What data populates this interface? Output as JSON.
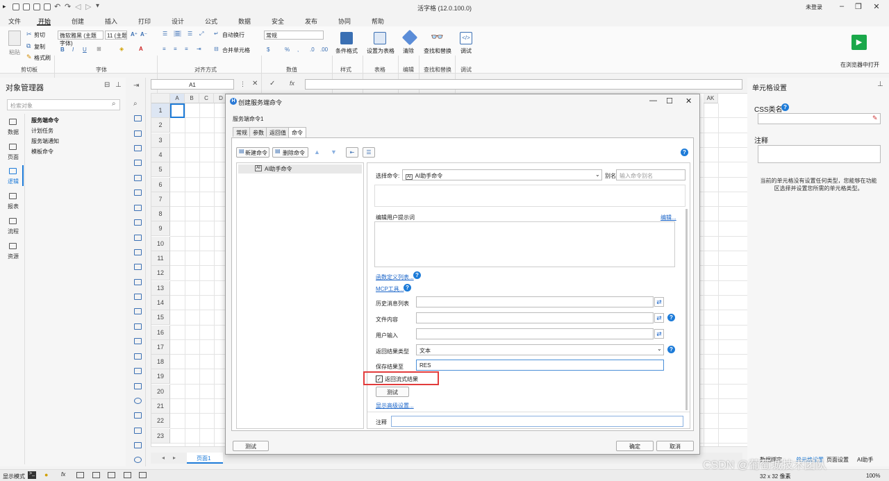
{
  "window": {
    "title": "活字格 (12.0.100.0)",
    "user": "未登录"
  },
  "menu": [
    "文件",
    "开始",
    "创建",
    "插入",
    "打印",
    "设计",
    "公式",
    "数据",
    "安全",
    "发布",
    "协同",
    "帮助"
  ],
  "ribbon": {
    "paste": "粘贴",
    "cut": "剪切",
    "copy": "复制",
    "format_painter": "格式刷",
    "clipboard": "剪切板",
    "font_name": "微软雅黑 (主题字体)",
    "font_size": "11 (主题字号)",
    "font": "字体",
    "wrap": "自动换行",
    "merge": "合并单元格",
    "alignment": "对齐方式",
    "number_format": "常规",
    "number": "数值",
    "cond_format": "条件格式",
    "style": "样式",
    "set_table": "设置为表格",
    "table": "表格",
    "clear": "清除",
    "edit": "编辑",
    "find_replace": "查找和替换",
    "debug": "调试",
    "open_browser": "在浏览器中打开"
  },
  "object_manager": {
    "title": "对象管理器",
    "search_placeholder": "检索对象",
    "nav": [
      "数据",
      "页面",
      "逻辑",
      "报表",
      "流程",
      "资源"
    ],
    "tree": [
      "服务端命令",
      "计划任务",
      "服务端通知",
      "模板命令"
    ]
  },
  "formula": {
    "cell_ref": "A1"
  },
  "grid": {
    "columns": [
      "A",
      "B",
      "C",
      "D",
      "AK"
    ],
    "rows": [
      "1",
      "2",
      "3",
      "4",
      "5",
      "6",
      "7",
      "8",
      "9",
      "10",
      "11",
      "12",
      "13",
      "14",
      "15",
      "16",
      "17",
      "18",
      "19",
      "20",
      "21",
      "22",
      "23"
    ]
  },
  "sheet_tab": "页面1",
  "right_panel": {
    "title": "单元格设置",
    "css_label": "CSS类名",
    "note_label": "注释",
    "message": "当前的单元格没有设置任何类型，您能够在功能区选择并设置您所需的单元格类型。",
    "bottom_tabs": [
      "数据绑定",
      "单元格设置",
      "页面设置",
      "AI助手"
    ]
  },
  "status": {
    "mode": "显示模式",
    "size": "32 x 32 像素",
    "zoom": "100%"
  },
  "dialog": {
    "title": "创建服务端命令",
    "name": "服务端命令1",
    "tabs": [
      "常规",
      "参数",
      "返回值",
      "命令"
    ],
    "new_cmd": "新建命令",
    "delete_cmd": "删除命令",
    "command_item": "AI助手命令",
    "select_cmd_label": "选择命令:",
    "select_cmd_value": "AI助手命令",
    "alias_label": "别名",
    "alias_placeholder": "输入命令别名",
    "edit_prompt_label": "编辑用户提示词",
    "edit_link": "编辑...",
    "func_link": "函数定义列表...",
    "mcp_link": "MCP工具...",
    "history_label": "历史消息列表",
    "file_label": "文件内容",
    "user_input_label": "用户输入",
    "result_type_label": "返回结果类型",
    "result_type_value": "文本",
    "save_to_label": "保存结果至",
    "save_to_value": "RES",
    "stream_label": "返回流式结果",
    "stream_checked": true,
    "test_inner": "测试",
    "advanced_link": "显示高级设置...",
    "note_label": "注释",
    "test_btn": "测试",
    "ok_btn": "确定",
    "cancel_btn": "取消"
  },
  "watermark": "CSDN @葡萄城技术团队",
  "colors": {
    "highlight": "#e23b3b",
    "accent": "#1d7bd8",
    "run": "#1aa84a"
  }
}
